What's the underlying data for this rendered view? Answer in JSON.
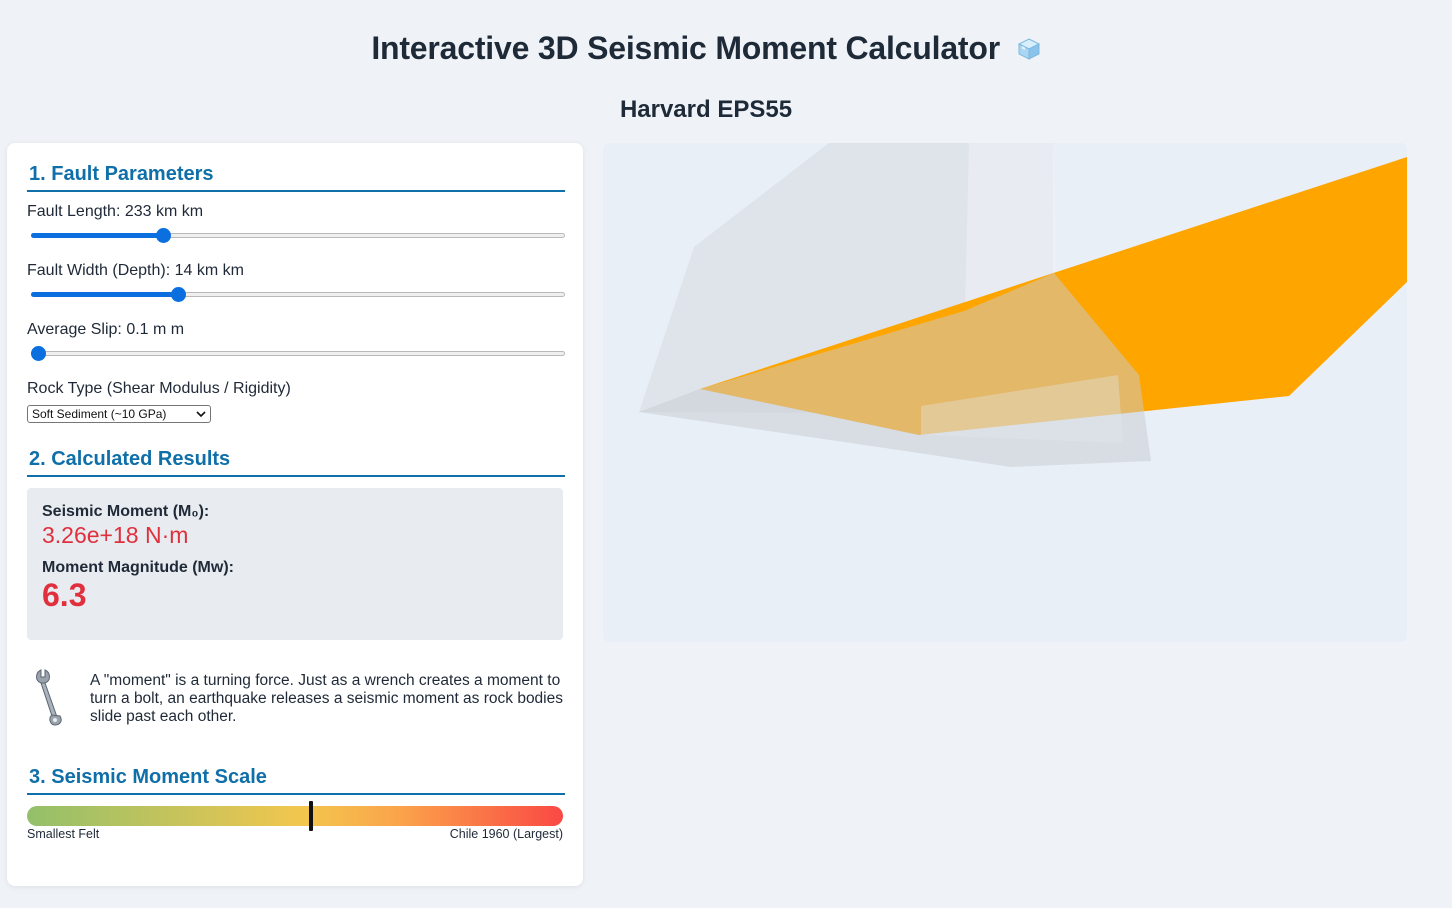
{
  "header": {
    "title": "Interactive 3D Seismic Moment Calculator",
    "title_icon": "ice-cube-icon",
    "subtitle": "Harvard EPS55"
  },
  "fault_parameters": {
    "heading": "1. Fault Parameters",
    "length": {
      "label": "Fault Length: 233 km km",
      "value": 233,
      "fraction": 0.24
    },
    "width": {
      "label": "Fault Width (Depth): 14 km km",
      "value": 14,
      "fraction": 0.27
    },
    "slip": {
      "label": "Average Slip: 0.1 m m",
      "value": 0.1,
      "fraction": 0.0
    },
    "rock_type": {
      "label": "Rock Type (Shear Modulus / Rigidity)",
      "selected": "Soft Sediment (~10 GPa)"
    }
  },
  "results": {
    "heading": "2. Calculated Results",
    "moment_label": "Seismic Moment (M₀):",
    "moment_value": "3.26e+18 N·m",
    "magnitude_label": "Moment Magnitude (Mw):",
    "magnitude_value": "6.3"
  },
  "analogy": {
    "icon": "wrench-icon",
    "text": "A \"moment\" is a turning force. Just as a wrench creates a moment to turn a bolt, an earthquake releases a seismic moment as rock bodies slide past each other."
  },
  "scale": {
    "heading": "3. Seismic Moment Scale",
    "min_label": "Smallest Felt",
    "max_label": "Chile 1960 (Largest)",
    "marker_fraction": 0.53
  },
  "colors": {
    "accent": "#0f6fa8",
    "result": "#e0303e",
    "slider": "#0b6fe0",
    "fault_plane": "#ffa500"
  }
}
